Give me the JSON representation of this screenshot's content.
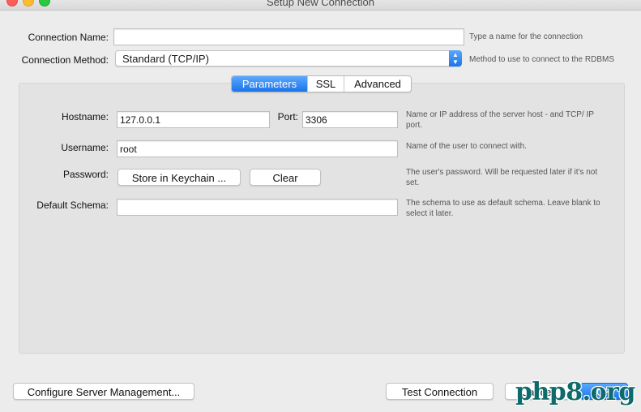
{
  "window": {
    "title": "Setup New Connection"
  },
  "connection": {
    "name_label": "Connection Name:",
    "name_value": "",
    "name_hint": "Type a name for the connection",
    "method_label": "Connection Method:",
    "method_value": "Standard (TCP/IP)",
    "method_hint": "Method to use to connect to the RDBMS"
  },
  "tabs": [
    {
      "label": "Parameters",
      "active": true
    },
    {
      "label": "SSL",
      "active": false
    },
    {
      "label": "Advanced",
      "active": false
    }
  ],
  "parameters": {
    "hostname_label": "Hostname:",
    "hostname_value": "127.0.0.1",
    "port_label": "Port:",
    "port_value": "3306",
    "hostname_hint": "Name or IP address of the server host - and TCP/ IP port.",
    "username_label": "Username:",
    "username_value": "root",
    "username_hint": "Name of the user to connect with.",
    "password_label": "Password:",
    "store_keychain_label": "Store in Keychain ...",
    "clear_label": "Clear",
    "password_hint": "The user's password. Will be requested later if it's not set.",
    "schema_label": "Default Schema:",
    "schema_value": "",
    "schema_hint": "The schema to use as default schema. Leave blank to select it later."
  },
  "footer": {
    "configure_label": "Configure Server Management...",
    "test_label": "Test Connection",
    "cancel_label": "Cancel",
    "ok_label": "OK"
  },
  "watermark": {
    "text": "php8.org"
  },
  "colors": {
    "accent": "#1a73e8",
    "panel": "#e3e3e3",
    "window": "#ececec"
  }
}
